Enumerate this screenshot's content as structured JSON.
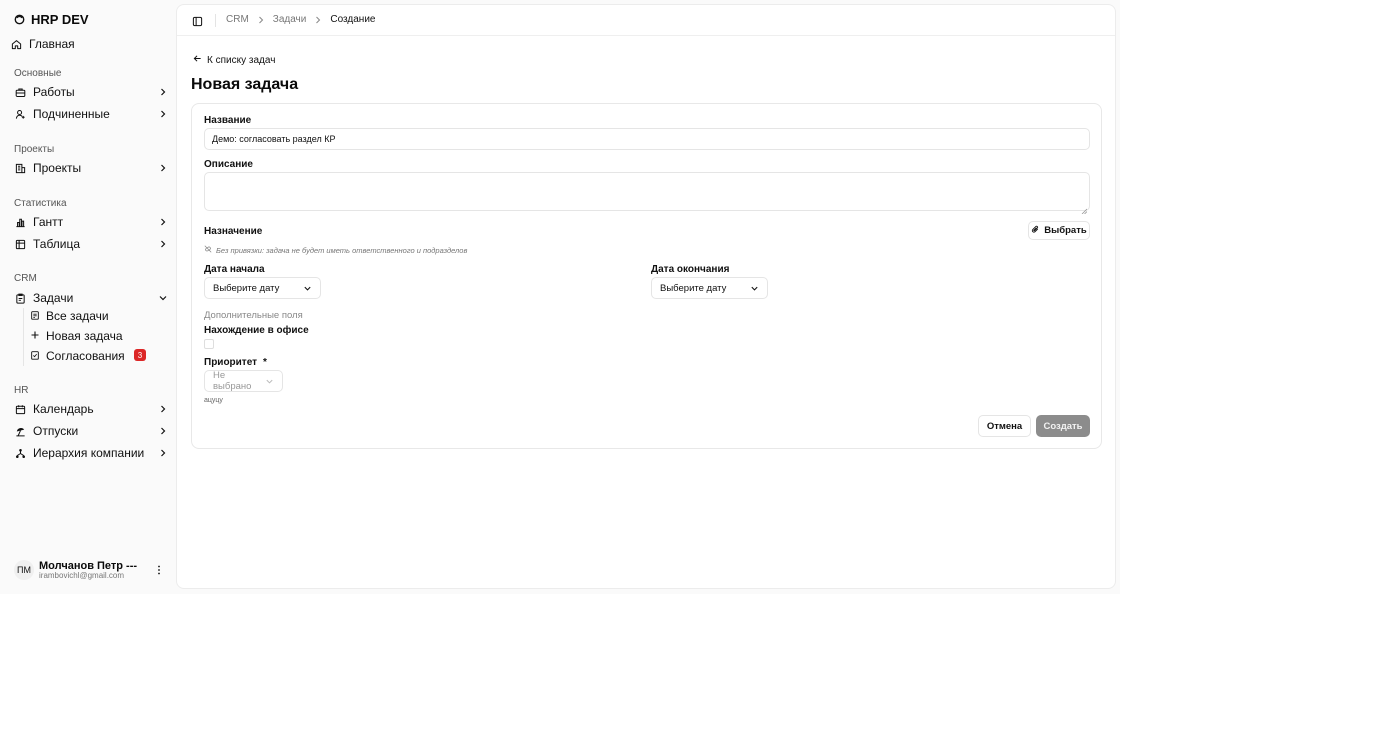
{
  "app": {
    "brand": "HRP DEV"
  },
  "sidebar": {
    "home": "Главная",
    "groups": [
      {
        "label": "Основные",
        "items": [
          "Работы",
          "Подчиненные"
        ]
      },
      {
        "label": "Проекты",
        "items": [
          "Проекты"
        ]
      },
      {
        "label": "Статистика",
        "items": [
          "Гантт",
          "Таблица"
        ]
      },
      {
        "label": "CRM",
        "items": [
          "Задачи"
        ]
      },
      {
        "label": "HR",
        "items": [
          "Календарь",
          "Отпуски",
          "Иерархия компании"
        ]
      }
    ],
    "tasks_sub": [
      "Все задачи",
      "Новая задача",
      "Согласования"
    ],
    "approvals_badge": "3"
  },
  "user": {
    "initials": "ПМ",
    "name": "Молчанов Петр ---",
    "email": "irambovichl@gmail.com"
  },
  "breadcrumb": [
    "CRM",
    "Задачи",
    "Создание"
  ],
  "page": {
    "back_link": "К списку задач",
    "title": "Новая задача"
  },
  "form": {
    "name_label": "Название",
    "name_value": "Демо: согласовать раздел КР",
    "description_label": "Описание",
    "assignment_label": "Назначение",
    "assignment_hint": "Без привязки: задача не будет иметь ответственного и подразделов",
    "select_button": "Выбрать",
    "start_date_label": "Дата начала",
    "start_date_placeholder": "Выберите дату",
    "end_date_label": "Дата окончания",
    "end_date_placeholder": "Выберите дату",
    "extra_fields_label": "Дополнительные поля",
    "office_label": "Нахождение в офисе",
    "priority_label": "Приоритет",
    "priority_required_mark": "*",
    "priority_value": "Не выбрано",
    "priority_note": "ацуцу",
    "cancel_button": "Отмена",
    "create_button": "Создать"
  }
}
